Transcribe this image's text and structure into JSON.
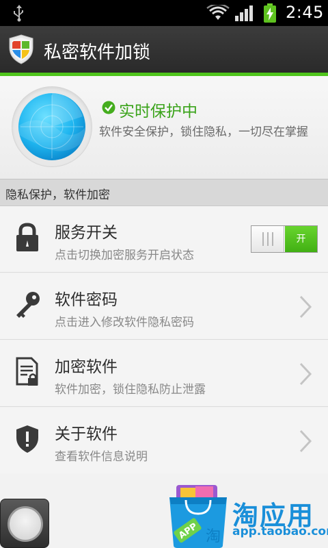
{
  "status_bar": {
    "time": "2:45",
    "icons": [
      "usb-icon",
      "wifi-icon",
      "signal-icon",
      "battery-charging-icon"
    ]
  },
  "app": {
    "title": "私密软件加锁",
    "accent_color": "#4fc51c"
  },
  "protection": {
    "title": "实时保护中",
    "description": "软件安全保护，锁住隐私，一切尽在掌握",
    "title_color": "#3aa31a"
  },
  "section": {
    "label": "隐私保护，软件加密"
  },
  "rows": [
    {
      "icon": "lock-icon",
      "title": "服务开关",
      "subtitle": "点击切换加密服务开启状态",
      "toggle_label": "开",
      "toggle_on": true
    },
    {
      "icon": "key-icon",
      "title": "软件密码",
      "subtitle": "点击进入修改软件隐私密码"
    },
    {
      "icon": "document-lock-icon",
      "title": "加密软件",
      "subtitle": "软件加密，锁住隐私防止泄露"
    },
    {
      "icon": "shield-alert-icon",
      "title": "关于软件",
      "subtitle": "查看软件信息说明"
    }
  ],
  "watermark": {
    "name": "淘应用",
    "url": "app.taobao.com",
    "tag_text": "APP",
    "bag_char": "淘"
  }
}
